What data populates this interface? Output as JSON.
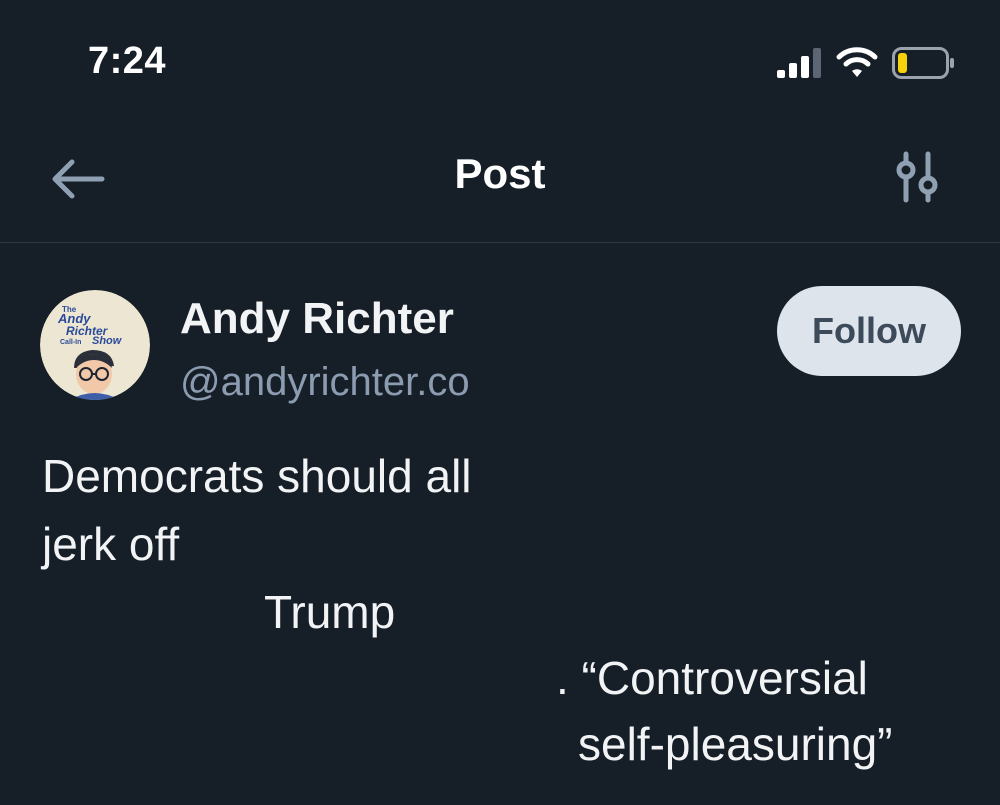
{
  "status_bar": {
    "time": "7:24",
    "signal_icon": "cellular-signal-icon",
    "wifi_icon": "wifi-icon",
    "battery_icon": "battery-low-icon",
    "battery_level": 0.2,
    "battery_color": "#f5d20a"
  },
  "nav": {
    "title": "Post",
    "back_icon": "arrow-left-icon",
    "filter_icon": "sliders-icon"
  },
  "author": {
    "name": "Andy Richter",
    "handle": "@andyrichter.co",
    "avatar_text": [
      "The",
      "Andy",
      "Richter",
      "Call-In",
      "Show"
    ],
    "follow_label": "Follow"
  },
  "post": {
    "lines": [
      "Democrats should all",
      "jerk off",
      "Trump",
      ". “Controversial",
      "self-pleasuring”"
    ]
  },
  "colors": {
    "background": "#161e27",
    "divider": "#2c3947",
    "text": "#f1f3f5",
    "handle": "#8c9cb0",
    "follow_bg": "#dde4ec",
    "follow_text": "#3c4a5a",
    "icon": "#8fa0b3"
  }
}
